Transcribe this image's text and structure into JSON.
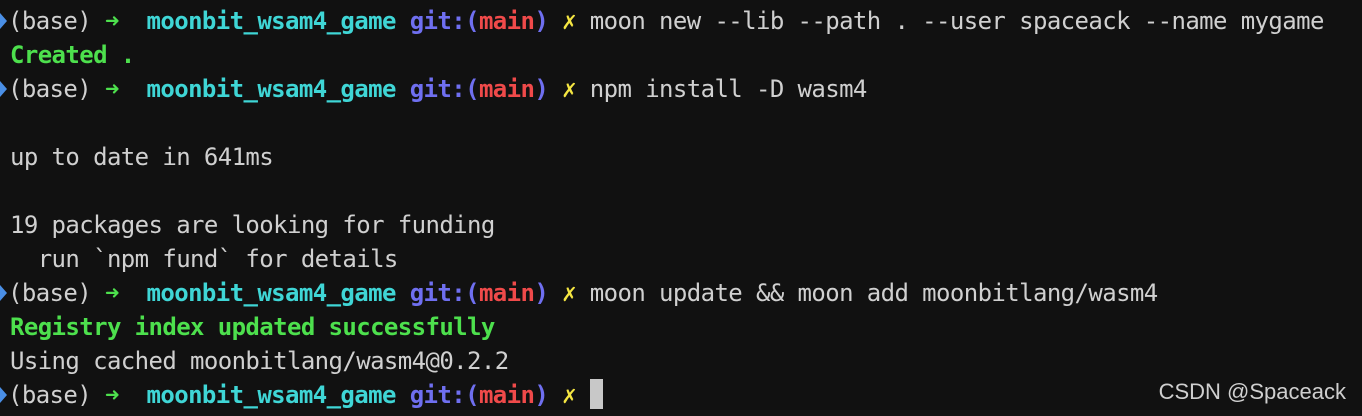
{
  "colors": {
    "background": "#111111",
    "default_text": "#d0d0d0",
    "prompt_marker": "#4a8fe6",
    "arrow": "#4de04d",
    "directory": "#3fd6d6",
    "git_label": "#6f6ff0",
    "branch": "#f04a4a",
    "dirty_mark": "#f5e642",
    "success_text": "#4de04d",
    "cursor": "#c8c8c8",
    "watermark": "#cfcfcf"
  },
  "icons": {
    "prompt_marker": "triangle-right-icon",
    "cursor": "block-cursor-icon"
  },
  "prompt": {
    "env": "(base)",
    "arrow": "➜",
    "directory": "moonbit_wsam4_game",
    "git_label": "git:",
    "branch_open": "(",
    "branch": "main",
    "branch_close": ")",
    "dirty_mark": "✗"
  },
  "lines": [
    {
      "kind": "prompt",
      "command": "moon new --lib --path . --user spaceack --name mygame"
    },
    {
      "kind": "success",
      "text": "Created ."
    },
    {
      "kind": "prompt",
      "command": "npm install -D wasm4"
    },
    {
      "kind": "blank",
      "text": ""
    },
    {
      "kind": "output",
      "text": "up to date in 641ms"
    },
    {
      "kind": "blank",
      "text": ""
    },
    {
      "kind": "output",
      "text": "19 packages are looking for funding"
    },
    {
      "kind": "output",
      "text": "  run `npm fund` for details"
    },
    {
      "kind": "prompt",
      "command": "moon update && moon add moonbitlang/wasm4"
    },
    {
      "kind": "success",
      "text": "Registry index updated successfully"
    },
    {
      "kind": "output",
      "text": "Using cached moonbitlang/wasm4@0.2.2"
    },
    {
      "kind": "prompt",
      "command": "",
      "cursor": true
    }
  ],
  "watermark": "CSDN @Spaceack"
}
